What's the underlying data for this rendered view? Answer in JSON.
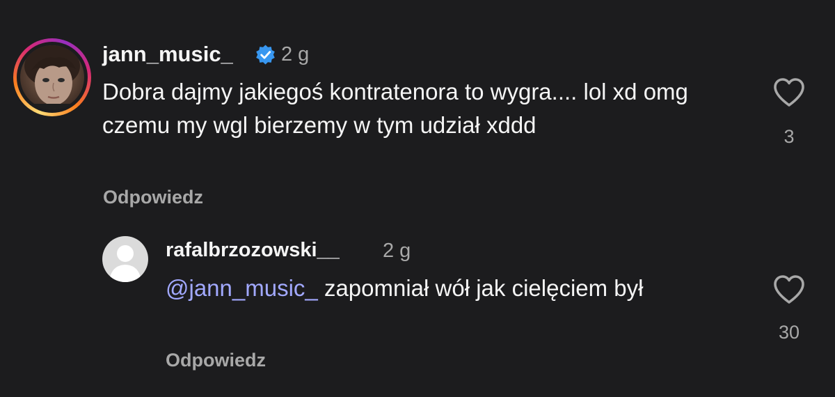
{
  "comments": [
    {
      "username": "jann_music_",
      "verified": true,
      "time": "2 g",
      "text": "Dobra dajmy jakiegoś kontratenora to wygra.... lol xd omg czemu my wgl bierzemy w tym udział xddd",
      "likes": "3",
      "reply_label": "Odpowiedz",
      "like_icon": "heart-outline-icon"
    }
  ],
  "replies": [
    {
      "username": "rafalbrzozowski__",
      "time": "2 g",
      "mention": "@jann_music_",
      "text": " zapomniał wół jak cielęciem był",
      "likes": "30",
      "reply_label": "Odpowiedz",
      "like_icon": "heart-outline-icon"
    }
  ],
  "colors": {
    "background": "#1c1c1e",
    "text": "#f5f5f5",
    "muted": "#a8a8a8",
    "mention": "#a2a9ff",
    "verified": "#3897f0"
  }
}
